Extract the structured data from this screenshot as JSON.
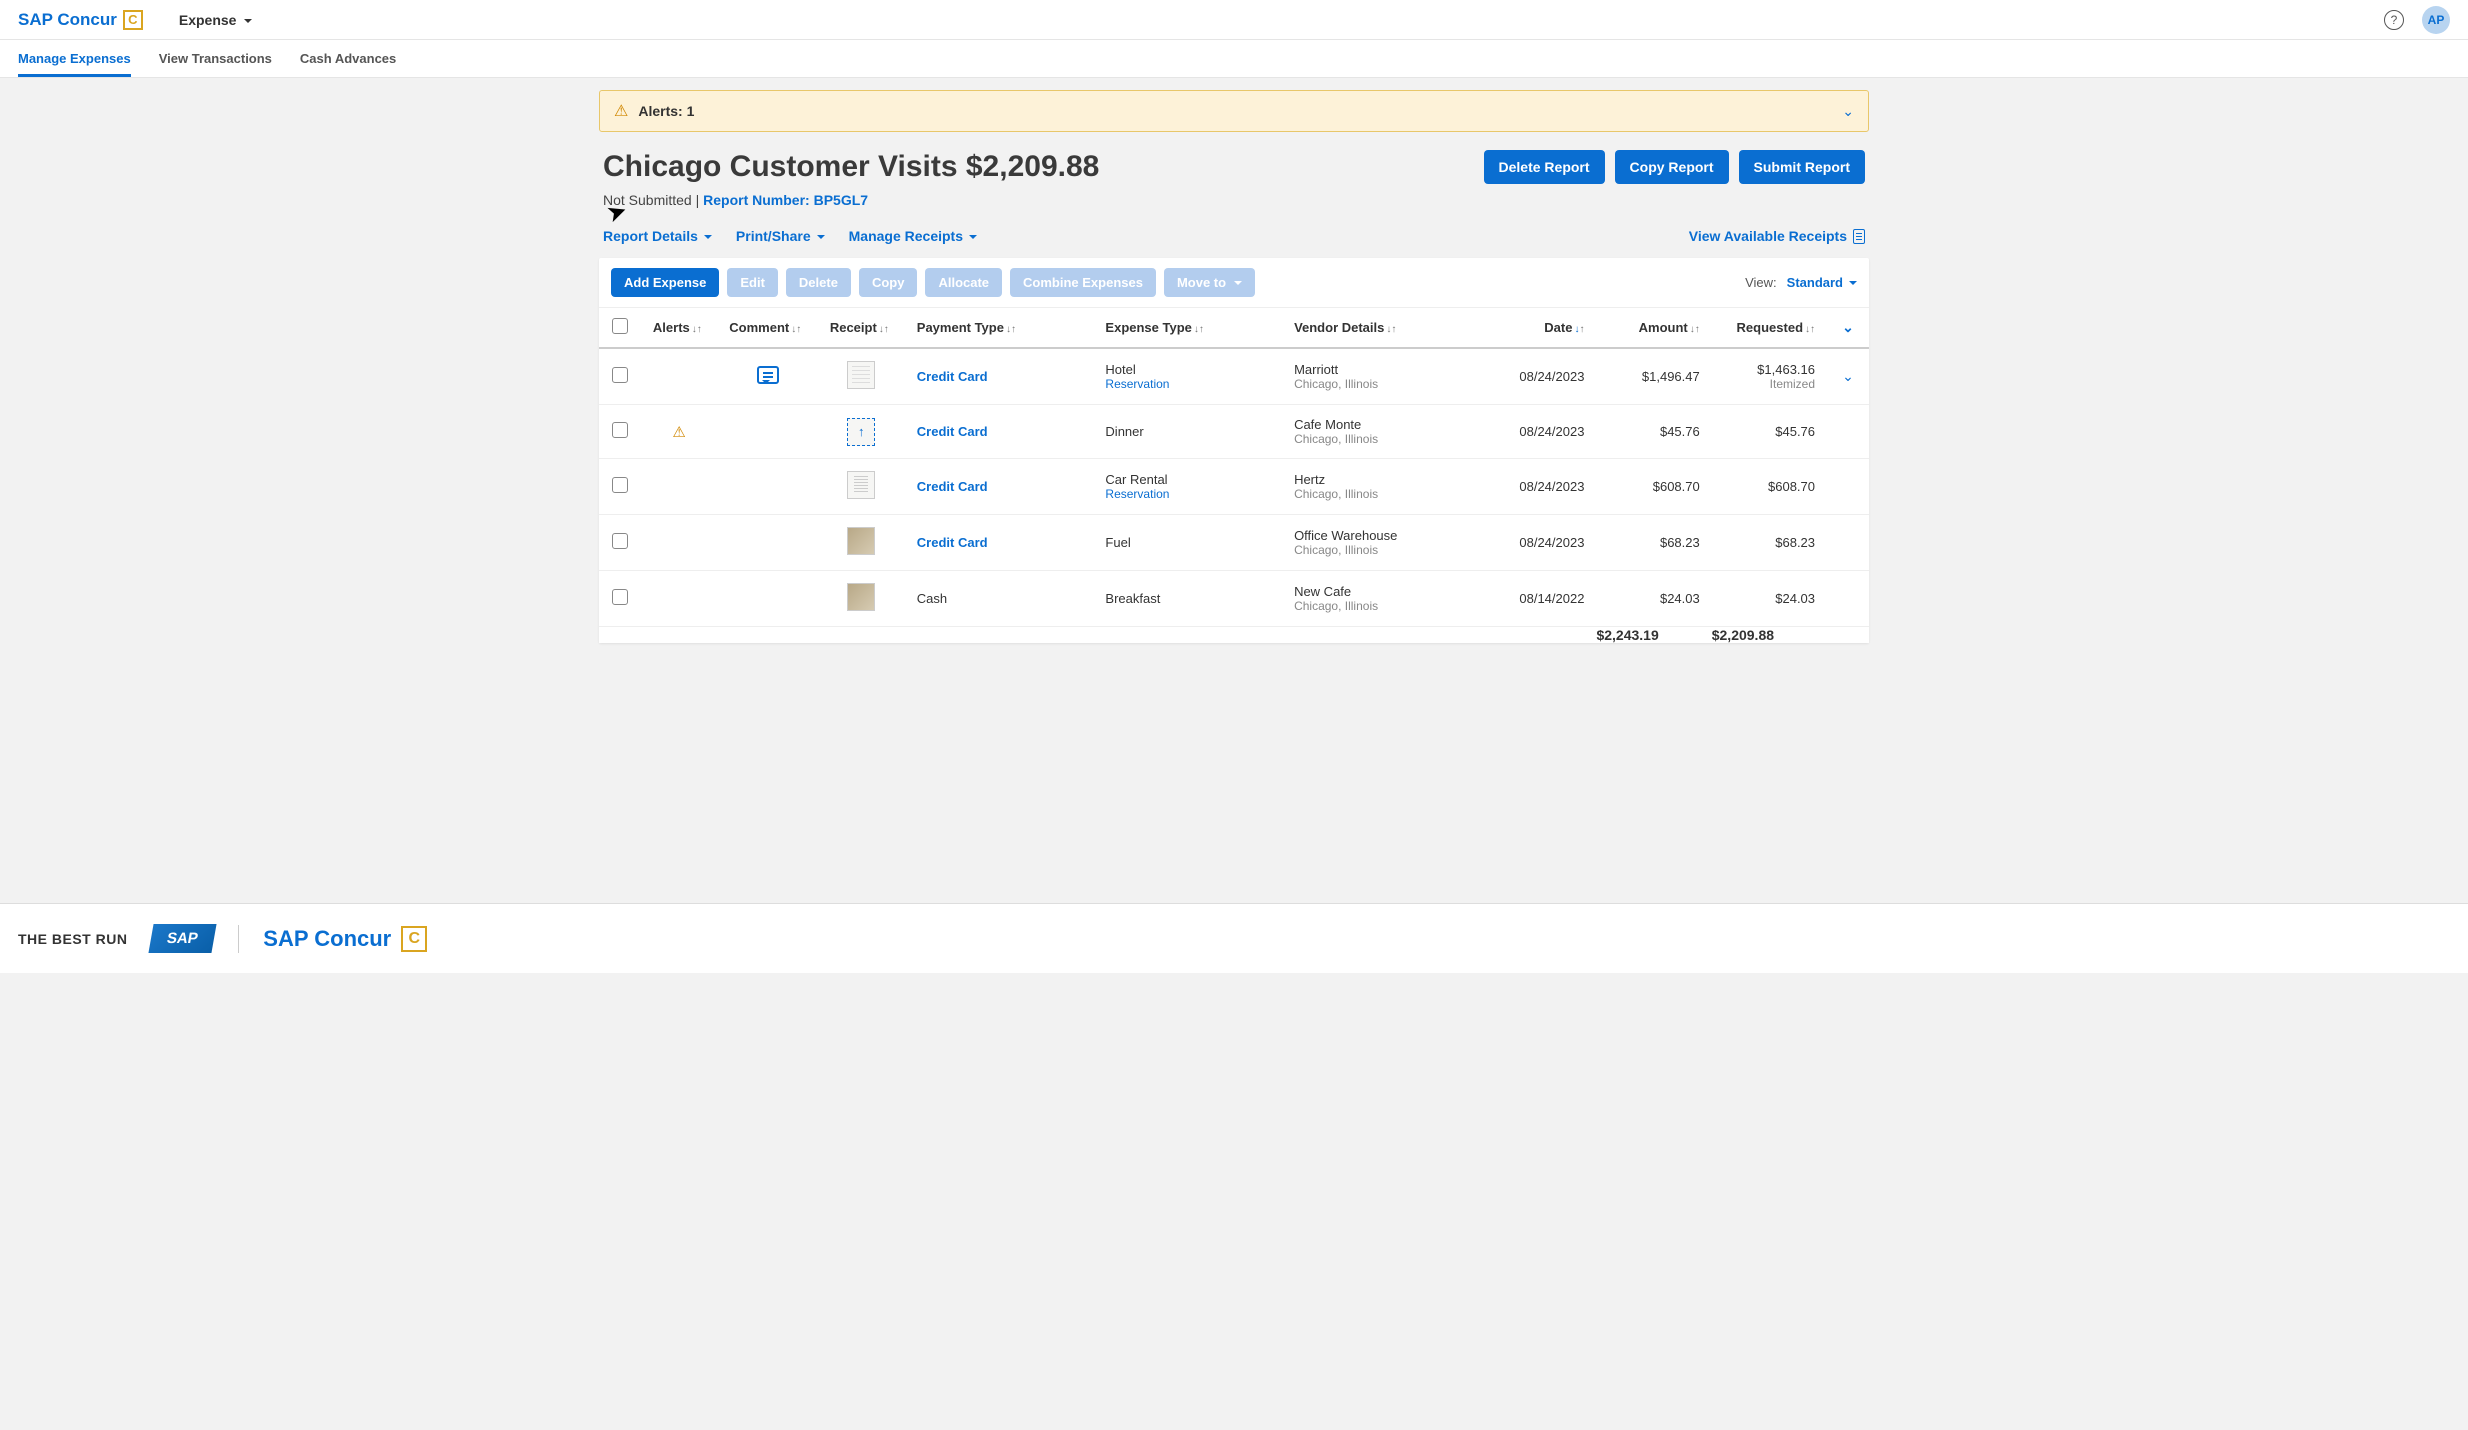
{
  "header": {
    "brand": "SAP Concur",
    "brand_badge": "C",
    "menu": "Expense",
    "avatar": "AP"
  },
  "tabs": [
    "Manage Expenses",
    "View Transactions",
    "Cash Advances"
  ],
  "alerts_banner": {
    "label": "Alerts: 1"
  },
  "report": {
    "title": "Chicago Customer Visits $2,209.88",
    "status": "Not Submitted",
    "report_number_label": "Report Number: BP5GL7"
  },
  "action_buttons": {
    "delete": "Delete Report",
    "copy": "Copy Report",
    "submit": "Submit Report"
  },
  "detail_links": {
    "report_details": "Report Details",
    "print_share": "Print/Share",
    "manage_receipts": "Manage Receipts",
    "view_available_receipts": "View Available Receipts"
  },
  "row_actions": {
    "add": "Add Expense",
    "edit": "Edit",
    "delete": "Delete",
    "copy": "Copy",
    "allocate": "Allocate",
    "combine": "Combine Expenses",
    "move_to": "Move to"
  },
  "view": {
    "label": "View:",
    "selected": "Standard"
  },
  "columns": {
    "alerts": "Alerts",
    "comment": "Comment",
    "receipt": "Receipt",
    "payment_type": "Payment Type",
    "expense_type": "Expense Type",
    "vendor_details": "Vendor Details",
    "date": "Date",
    "amount": "Amount",
    "requested": "Requested"
  },
  "rows": [
    {
      "alert": false,
      "has_comment": true,
      "receipt": "form",
      "payment_type": "Credit Card",
      "expense_type": "Hotel",
      "expense_sub": "Reservation",
      "vendor": "Marriott",
      "vendor_loc": "Chicago, Illinois",
      "date": "08/24/2023",
      "amount": "$1,496.47",
      "requested": "$1,463.16",
      "requested_sub": "Itemized",
      "expand": true
    },
    {
      "alert": true,
      "has_comment": false,
      "receipt": "upload",
      "payment_type": "Credit Card",
      "expense_type": "Dinner",
      "expense_sub": "",
      "vendor": "Cafe Monte",
      "vendor_loc": "Chicago, Illinois",
      "date": "08/24/2023",
      "amount": "$45.76",
      "requested": "$45.76",
      "requested_sub": "",
      "expand": false
    },
    {
      "alert": false,
      "has_comment": false,
      "receipt": "doc",
      "payment_type": "Credit Card",
      "expense_type": "Car Rental",
      "expense_sub": "Reservation",
      "vendor": "Hertz",
      "vendor_loc": "Chicago, Illinois",
      "date": "08/24/2023",
      "amount": "$608.70",
      "requested": "$608.70",
      "requested_sub": "",
      "expand": false
    },
    {
      "alert": false,
      "has_comment": false,
      "receipt": "img",
      "payment_type": "Credit Card",
      "expense_type": "Fuel",
      "expense_sub": "",
      "vendor": "Office Warehouse",
      "vendor_loc": "Chicago, Illinois",
      "date": "08/24/2023",
      "amount": "$68.23",
      "requested": "$68.23",
      "requested_sub": "",
      "expand": false
    },
    {
      "alert": false,
      "has_comment": false,
      "receipt": "img",
      "payment_type": "Cash",
      "payment_plain": true,
      "expense_type": "Breakfast",
      "expense_sub": "",
      "vendor": "New Cafe",
      "vendor_loc": "Chicago, Illinois",
      "date": "08/14/2022",
      "amount": "$24.03",
      "requested": "$24.03",
      "requested_sub": "",
      "expand": false
    }
  ],
  "totals": {
    "amount": "$2,243.19",
    "requested": "$2,209.88"
  },
  "footer": {
    "line": "THE BEST RUN",
    "sap": "SAP",
    "brand": "SAP Concur",
    "brand_badge": "C"
  }
}
